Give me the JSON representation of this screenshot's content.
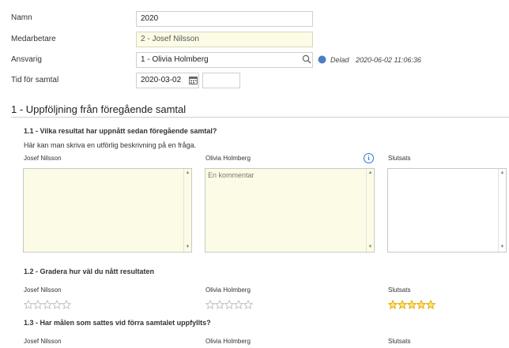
{
  "form": {
    "namn_label": "Namn",
    "namn_value": "2020",
    "medarbetare_label": "Medarbetare",
    "medarbetare_value": "2 - Josef Nilsson",
    "ansvarig_label": "Ansvarig",
    "ansvarig_value": "1 - Olivia Holmberg",
    "status_text": "Delad",
    "status_timestamp": "2020-06-02 11:06:36",
    "status_color": "#4a7fc1",
    "tid_label": "Tid för samtal",
    "tid_date": "2020-03-02",
    "tid_time": ""
  },
  "section": {
    "title": "1 - Uppföljning från föregående samtal",
    "questions": [
      {
        "title": "1.1 - Vilka resultat har uppnått sedan föregående samtal?",
        "description": "Här kan man skriva en utförlig beskrivning på en fråga.",
        "columns": [
          "Josef Nilsson",
          "Olivia Holmberg",
          "Slutsats"
        ],
        "answers": [
          "",
          "En kommentar",
          ""
        ]
      },
      {
        "title": "1.2 - Gradera hur väl du nått resultaten",
        "columns": [
          "Josef Nilsson",
          "Olivia Holmberg",
          "Slutsats"
        ],
        "ratings": [
          0,
          0,
          5
        ],
        "max_rating": 5
      },
      {
        "title": "1.3 - Har målen som sattes vid förra samtalet uppfyllts?",
        "columns": [
          "Josef Nilsson",
          "Olivia Holmberg",
          "Slutsats"
        ]
      }
    ]
  },
  "colors": {
    "readonly_bg": "#fcfce6",
    "star_filled": "#e0a800",
    "star_empty": "#bdbdbd",
    "info_blue": "#2b78c9"
  },
  "icons": {
    "search": "search-icon",
    "calendar": "calendar-icon",
    "info": "info-icon",
    "star": "star-icon"
  }
}
